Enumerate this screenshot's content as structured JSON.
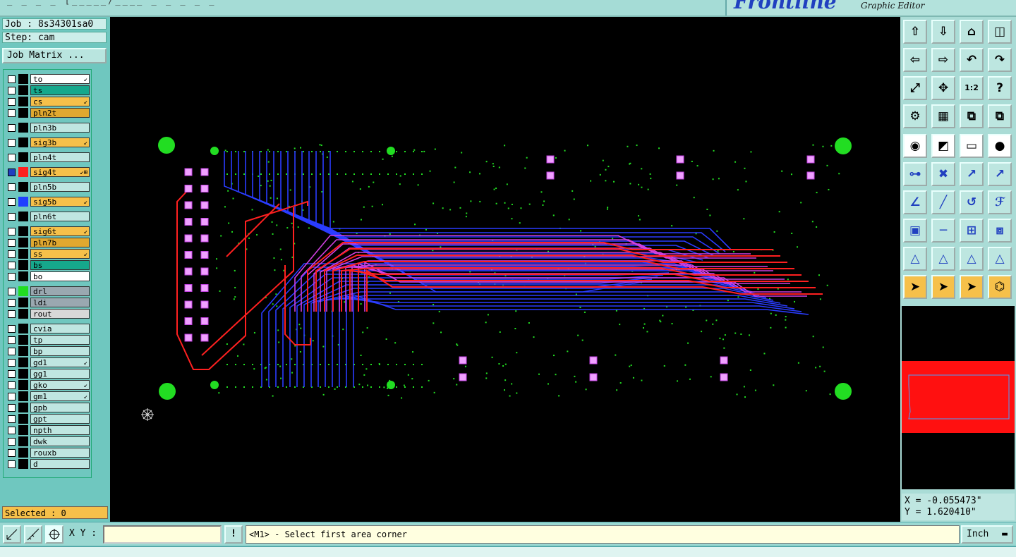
{
  "app": {
    "brand": "Frontline",
    "subtitle": "Graphic Editor",
    "menu_ghost": "_ _ _ _ [_____/____ _ _ _ _ _"
  },
  "job": {
    "job_text": "Job : 8s34301sa0",
    "step_text": "Step: cam",
    "matrix_button": "Job Matrix ..."
  },
  "layers": [
    {
      "name": "to",
      "color": "#ffffff",
      "swatch": "#000000",
      "icon": "↙"
    },
    {
      "name": "ts",
      "color": "#16a88c",
      "swatch": "#000000",
      "icon": ""
    },
    {
      "name": "cs",
      "color": "#f6c04a",
      "swatch": "#000000",
      "icon": "↙"
    },
    {
      "name": "pln2t",
      "color": "#e0a830",
      "swatch": "#000000",
      "icon": ""
    },
    {
      "name": "pln3b",
      "color": "#bfe6e1",
      "swatch": "#000000",
      "icon": ""
    },
    {
      "name": "sig3b",
      "color": "#f6c04a",
      "swatch": "#000000",
      "icon": "↙"
    },
    {
      "name": "pln4t",
      "color": "#bfe6e1",
      "swatch": "#000000",
      "icon": ""
    },
    {
      "name": "sig4t",
      "color": "#f6c04a",
      "swatch": "#ff2020",
      "icon": "↙⊞",
      "sel": true
    },
    {
      "name": "pln5b",
      "color": "#bfe6e1",
      "swatch": "#000000",
      "icon": ""
    },
    {
      "name": "sig5b",
      "color": "#f6c04a",
      "swatch": "#2040ff",
      "icon": "↙"
    },
    {
      "name": "pln6t",
      "color": "#bfe6e1",
      "swatch": "#000000",
      "icon": ""
    },
    {
      "name": "sig6t",
      "color": "#f6c04a",
      "swatch": "#000000",
      "icon": "↙"
    },
    {
      "name": "pln7b",
      "color": "#e0a830",
      "swatch": "#000000",
      "icon": ""
    },
    {
      "name": "ss",
      "color": "#f6c04a",
      "swatch": "#000000",
      "icon": "↙"
    },
    {
      "name": "bs",
      "color": "#16a88c",
      "swatch": "#000000",
      "icon": ""
    },
    {
      "name": "bo",
      "color": "#ffffff",
      "swatch": "#000000",
      "icon": ""
    },
    {
      "name": "drl",
      "color": "#9aa8b0",
      "swatch": "#22dd22",
      "icon": ""
    },
    {
      "name": "ldi",
      "color": "#9aa8b0",
      "swatch": "#000000",
      "icon": ""
    },
    {
      "name": "rout",
      "color": "#d8d8d8",
      "swatch": "#000000",
      "icon": ""
    },
    {
      "name": "cvia",
      "color": "#bfe6e1",
      "swatch": "#000000",
      "icon": ""
    },
    {
      "name": "tp",
      "color": "#bfe6e1",
      "swatch": "#000000",
      "icon": ""
    },
    {
      "name": "bp",
      "color": "#bfe6e1",
      "swatch": "#000000",
      "icon": ""
    },
    {
      "name": "gd1",
      "color": "#bfe6e1",
      "swatch": "#000000",
      "icon": "↙"
    },
    {
      "name": "gg1",
      "color": "#bfe6e1",
      "swatch": "#000000",
      "icon": ""
    },
    {
      "name": "gko",
      "color": "#bfe6e1",
      "swatch": "#000000",
      "icon": "↙"
    },
    {
      "name": "gm1",
      "color": "#bfe6e1",
      "swatch": "#000000",
      "icon": "↙"
    },
    {
      "name": "gpb",
      "color": "#bfe6e1",
      "swatch": "#000000",
      "icon": ""
    },
    {
      "name": "gpt",
      "color": "#bfe6e1",
      "swatch": "#000000",
      "icon": ""
    },
    {
      "name": "npth",
      "color": "#bfe6e1",
      "swatch": "#000000",
      "icon": ""
    },
    {
      "name": "dwk",
      "color": "#bfe6e1",
      "swatch": "#000000",
      "icon": ""
    },
    {
      "name": "rouxb",
      "color": "#bfe6e1",
      "swatch": "#000000",
      "icon": ""
    },
    {
      "name": "d",
      "color": "#bfe6e1",
      "swatch": "#000000",
      "icon": ""
    }
  ],
  "selected_text": "Selected : 0",
  "coords": {
    "x": "X = -0.055473\"",
    "y": "Y = 1.620410\""
  },
  "bottom": {
    "xy_label": "X Y :",
    "xy_value": "",
    "alert": "!",
    "message": "<M1> - Select first area corner",
    "unit": "Inch"
  },
  "colors": {
    "canvas": "#000000",
    "trace_blue": "#2a3cff",
    "trace_red": "#ff2020",
    "trace_magenta": "#d040e0",
    "pad_green": "#22dd22"
  },
  "toolbar_icons": [
    "zoom-home-icon",
    "zoom-in-area-icon",
    "home-icon",
    "window-icon",
    "pan-left-icon",
    "pan-right-icon",
    "undo-icon",
    "redo-icon",
    "fit-icon",
    "center-icon",
    "one-to-two-icon",
    "help-icon",
    "settings-icon",
    "grid-icon",
    "layer-filter-icon",
    "layer-filter-red-icon",
    "snap-icon",
    "draw-icon",
    "ruler-icon",
    "pad-icon",
    "connect-icon",
    "delete-icon",
    "move-icon",
    "copy-icon",
    "angle-icon",
    "line-icon",
    "arc-icon",
    "ff-icon",
    "add-pad-icon",
    "resize-icon",
    "measure-icon",
    "group-icon",
    "triangle-a-icon",
    "triangle-b-icon",
    "triangle-c-icon",
    "triangle-d-icon",
    "select-icon",
    "select-box-icon",
    "select-circle-icon",
    "select-net-icon"
  ]
}
